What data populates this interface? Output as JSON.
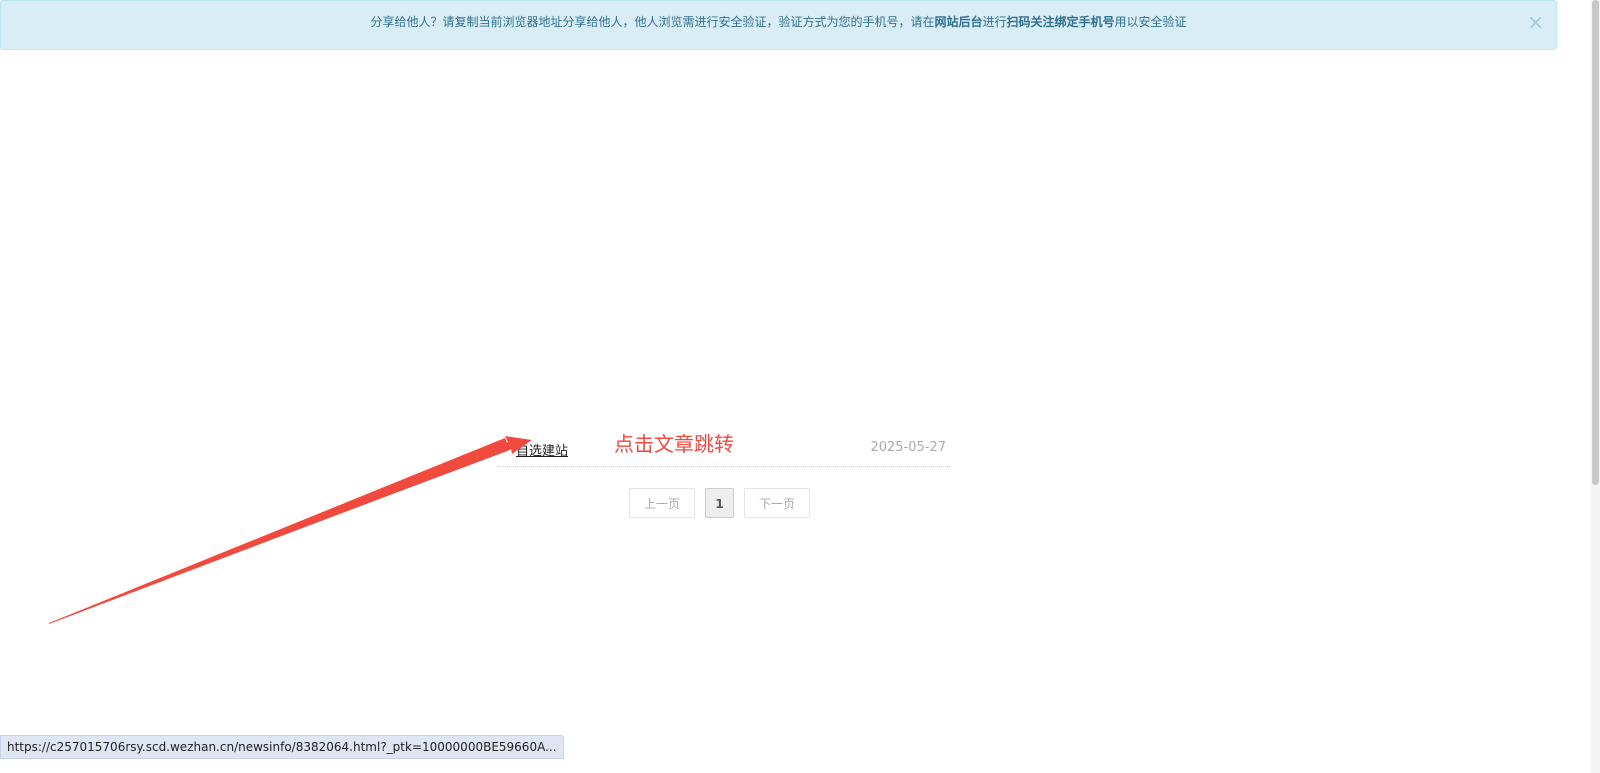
{
  "alert": {
    "text_1": "分享给他人？请复制当前浏览器地址分享给他人，他人浏览需进行安全验证，验证方式为您的手机号，请在",
    "bold_1": "网站后台",
    "text_2": "进行",
    "bold_2": "扫码关注绑定手机号",
    "text_3": "用以安全验证",
    "close": "×"
  },
  "article": {
    "title": "自选建站",
    "date": "2025-05-27"
  },
  "annotation": "点击文章跳转",
  "pagination": {
    "prev": "上一页",
    "current": "1",
    "next": "下一页"
  },
  "status_url": "https://c257015706rsy.scd.wezhan.cn/newsinfo/8382064.html?_ptk=10000000BE59660A...",
  "colors": {
    "annotation": "#f0493e",
    "alert_bg": "#d9edf7"
  }
}
